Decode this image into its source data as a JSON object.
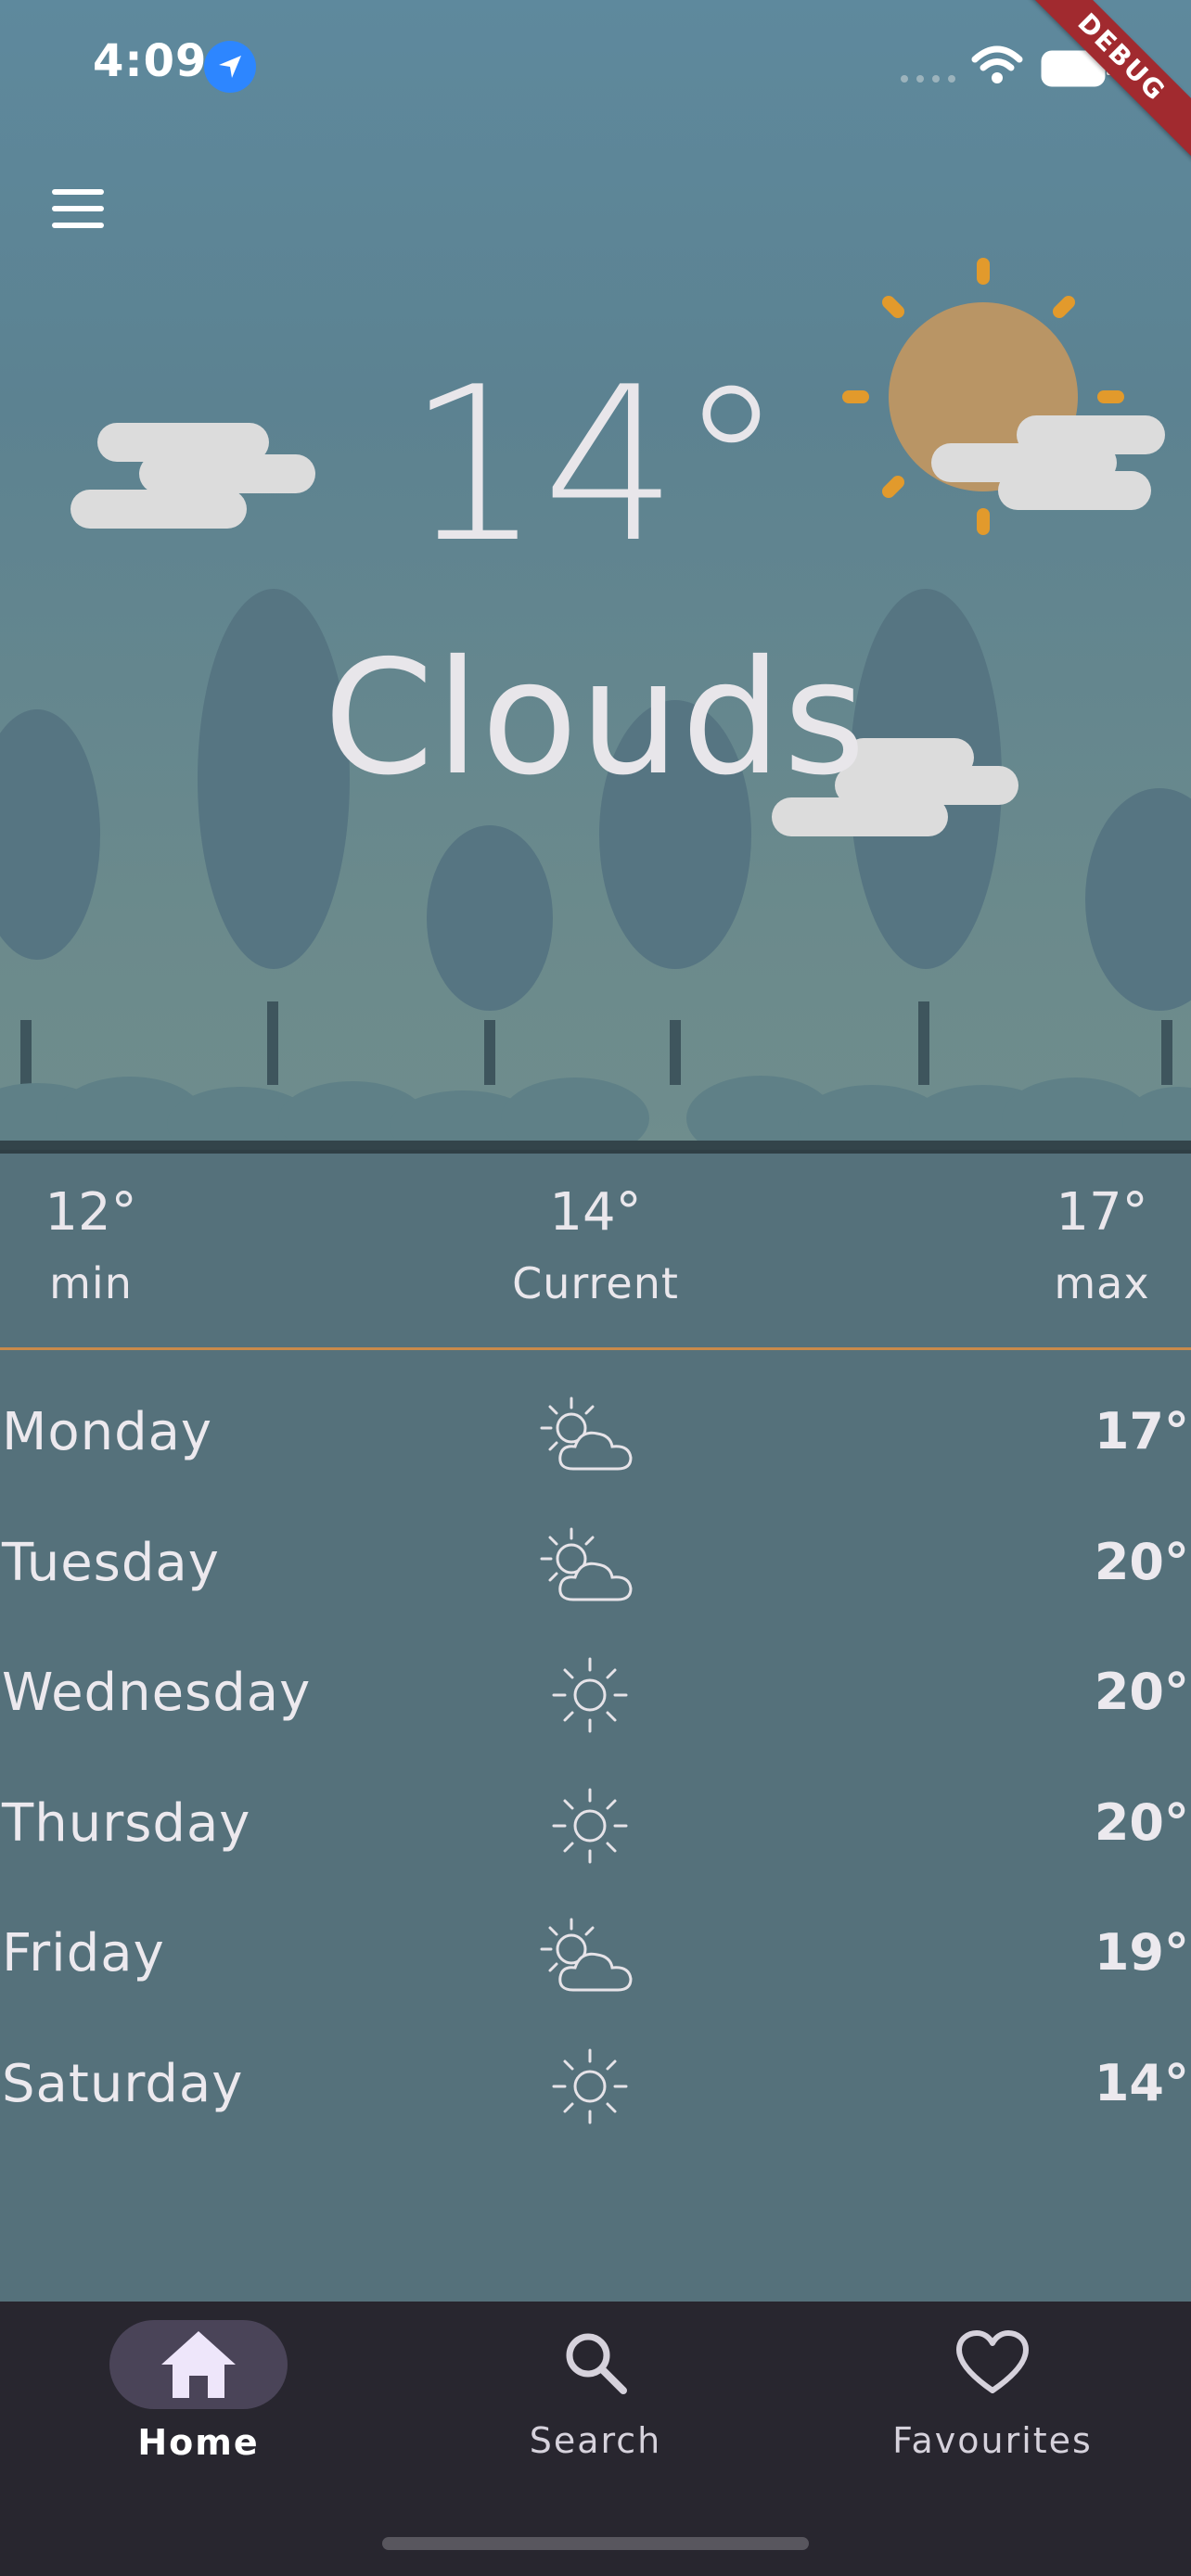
{
  "status_bar": {
    "time": "4:09",
    "location_icon": "location-arrow-icon",
    "wifi_icon": "wifi-icon",
    "battery_icon": "battery-icon"
  },
  "debug_banner": "DEBUG",
  "header": {
    "menu_icon": "menu-icon"
  },
  "current": {
    "temperature": "14°",
    "description": "Clouds"
  },
  "summary": {
    "min": {
      "value": "12°",
      "label": "min"
    },
    "current": {
      "value": "14°",
      "label": "Current"
    },
    "max": {
      "value": "17°",
      "label": "max"
    }
  },
  "forecast": [
    {
      "day": "Monday",
      "icon": "partly-cloudy-icon",
      "temp": "17°"
    },
    {
      "day": "Tuesday",
      "icon": "partly-cloudy-icon",
      "temp": "20°"
    },
    {
      "day": "Wednesday",
      "icon": "sun-icon",
      "temp": "20°"
    },
    {
      "day": "Thursday",
      "icon": "sun-icon",
      "temp": "20°"
    },
    {
      "day": "Friday",
      "icon": "partly-cloudy-icon",
      "temp": "19°"
    },
    {
      "day": "Saturday",
      "icon": "sun-icon",
      "temp": "14°"
    }
  ],
  "nav": {
    "items": [
      {
        "label": "Home",
        "icon": "home-icon",
        "active": true
      },
      {
        "label": "Search",
        "icon": "search-icon",
        "active": false
      },
      {
        "label": "Favourites",
        "icon": "heart-icon",
        "active": false
      }
    ]
  },
  "colors": {
    "sky_top": "#5e899d",
    "sky_bottom": "#6f8d8d",
    "panel": "#55717b",
    "divider_accent": "#c98a4b",
    "sun": "#b99565",
    "sun_rays": "#e29a2c",
    "nav_bg": "#28262f",
    "nav_pill": "#4a4458"
  }
}
